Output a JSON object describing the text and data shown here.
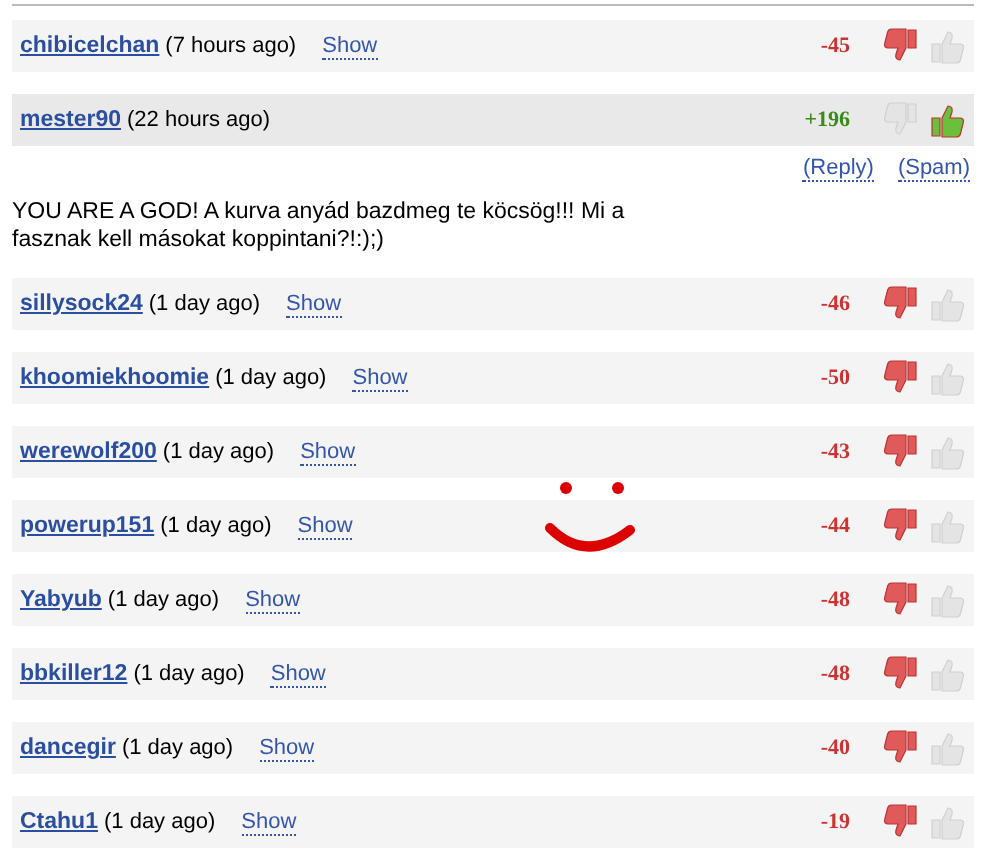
{
  "comments": [
    {
      "kind": "collapsed",
      "author": "chibicelchan",
      "time": "(7 hours ago)",
      "show": "Show",
      "score": "-45",
      "positive": false
    },
    {
      "kind": "expanded",
      "author": "mester90",
      "time": "(22 hours ago)",
      "score": "+196",
      "positive": true,
      "reply": "(Reply)",
      "spam": "(Spam)",
      "body": "YOU ARE A GOD! A kurva anyád bazdmeg te köcsög!!! Mi a fasznak kell másokat koppintani?!:);)"
    },
    {
      "kind": "collapsed",
      "author": "sillysock24",
      "time": "(1 day ago)",
      "show": "Show",
      "score": "-46",
      "positive": false
    },
    {
      "kind": "collapsed",
      "author": "khoomiekhoomie",
      "time": "(1 day ago)",
      "show": "Show",
      "score": "-50",
      "positive": false
    },
    {
      "kind": "collapsed",
      "author": "werewolf200",
      "time": "(1 day ago)",
      "show": "Show",
      "score": "-43",
      "positive": false
    },
    {
      "kind": "collapsed",
      "author": "powerup151",
      "time": "(1 day ago)",
      "show": "Show",
      "score": "-44",
      "positive": false
    },
    {
      "kind": "collapsed",
      "author": "Yabyub",
      "time": "(1 day ago)",
      "show": "Show",
      "score": "-48",
      "positive": false
    },
    {
      "kind": "collapsed",
      "author": "bbkiller12",
      "time": "(1 day ago)",
      "show": "Show",
      "score": "-48",
      "positive": false
    },
    {
      "kind": "collapsed",
      "author": "dancegir",
      "time": "(1 day ago)",
      "show": "Show",
      "score": "-40",
      "positive": false
    },
    {
      "kind": "collapsed",
      "author": "Ctahu1",
      "time": "(1 day ago)",
      "show": "Show",
      "score": "-19",
      "positive": false
    }
  ]
}
